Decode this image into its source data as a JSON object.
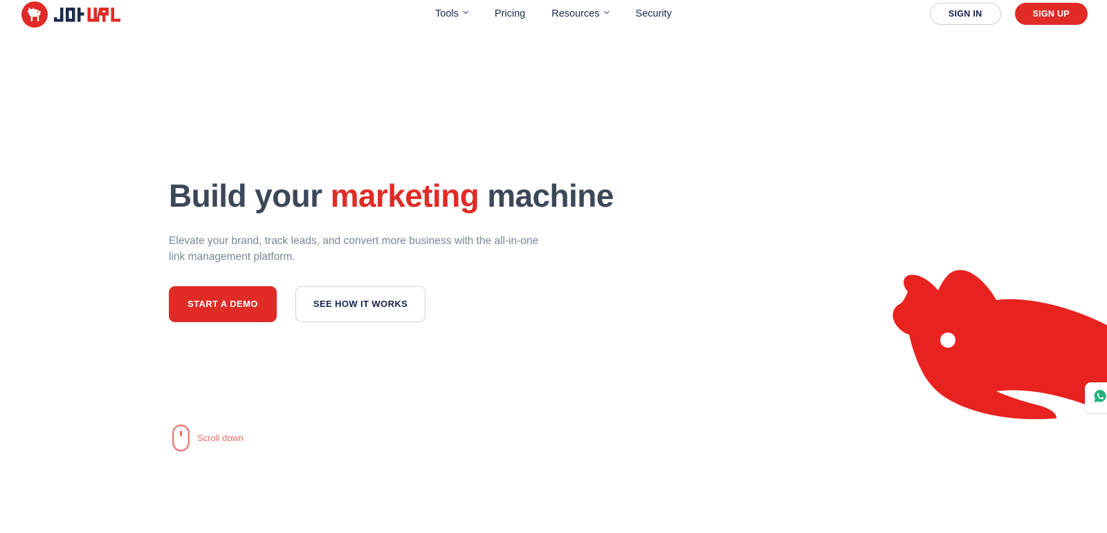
{
  "header": {
    "brand": {
      "name": "JotURL",
      "word_dark": "Jot",
      "word_red": "URL",
      "logo_icon": "dog-logo-icon",
      "brand_color": "#e02b27",
      "wordmark_dark_color": "#1c2b4a"
    },
    "nav": [
      {
        "label": "Tools",
        "has_dropdown": true,
        "icon": "chevron-down-icon"
      },
      {
        "label": "Pricing",
        "has_dropdown": false,
        "icon": ""
      },
      {
        "label": "Resources",
        "has_dropdown": true,
        "icon": "chevron-down-icon"
      },
      {
        "label": "Security",
        "has_dropdown": false,
        "icon": ""
      }
    ],
    "auth": {
      "sign_in_label": "SIGN IN",
      "sign_up_label": "SIGN UP"
    }
  },
  "hero": {
    "headline_part1": "Build your ",
    "headline_accent": "marketing",
    "headline_part2": " machine",
    "subheading": "Elevate your brand, track leads, and convert more business with the all-in-one link management platform.",
    "primary_cta": "START A DEMO",
    "secondary_cta": "SEE HOW IT WORKS",
    "accent_color": "#e02b27",
    "headline_color": "#3c4858",
    "subheading_color": "#7a8599"
  },
  "scroll": {
    "label": "Scroll down",
    "icon": "mouse-scroll-icon",
    "color": "#ec6a63"
  },
  "decor": {
    "mascot_icon": "dog-mascot-illustration",
    "mascot_color": "#e8231f"
  },
  "chat": {
    "icon": "whatsapp-chat-icon",
    "color": "#25b47e"
  }
}
